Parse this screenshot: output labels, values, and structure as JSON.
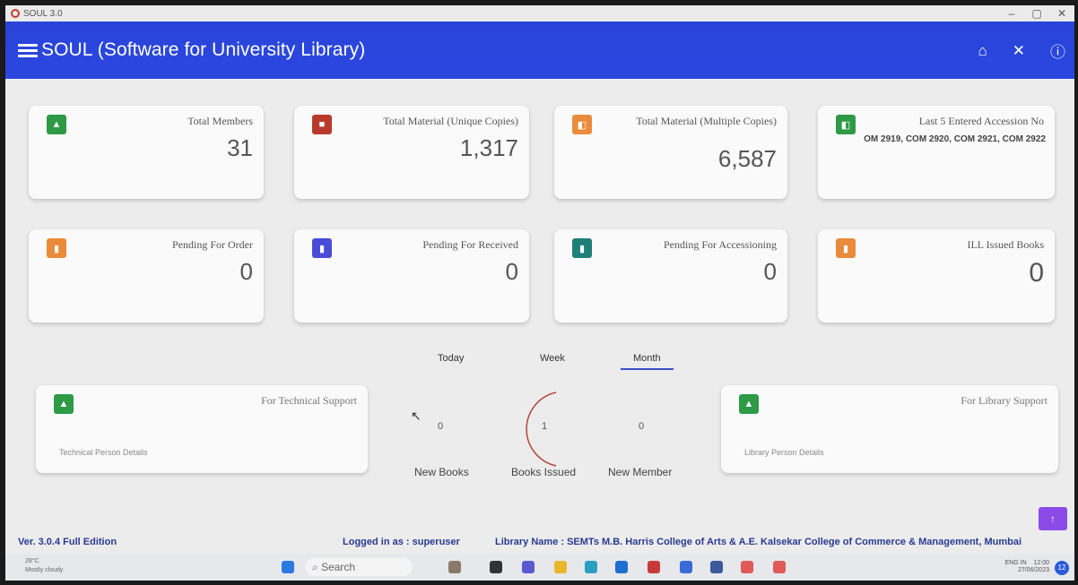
{
  "window": {
    "title": "SOUL 3.0",
    "min": "–",
    "max": "▢",
    "close": "✕"
  },
  "app": {
    "title": "SOUL (Software for University Library)"
  },
  "cards_top": [
    {
      "label": "Total Members",
      "value": "31",
      "color": "#2e9a46",
      "icon": "person-icon"
    },
    {
      "label": "Total Material (Unique Copies)",
      "value": "1,317",
      "color": "#b83a2c",
      "icon": "book-icon"
    },
    {
      "label": "Total Material (Multiple Copies)",
      "value": "6,587",
      "color": "#e98b3a",
      "icon": "copies-icon"
    },
    {
      "label": "Last 5 Entered Accession No",
      "value": "OM 2919, COM 2920, COM 2921, COM 2922",
      "color": "#2e9a46",
      "icon": "copies-icon"
    }
  ],
  "cards_mid": [
    {
      "label": "Pending For Order",
      "value": "0",
      "color": "#e98b3a",
      "icon": "bookmark-icon"
    },
    {
      "label": "Pending For Received",
      "value": "0",
      "color": "#4a4cd8",
      "icon": "bookmark-icon"
    },
    {
      "label": "Pending For Accessioning",
      "value": "0",
      "color": "#1f7f79",
      "icon": "bookmark-icon"
    },
    {
      "label": "ILL Issued Books",
      "value": "0",
      "color": "#e98b3a",
      "icon": "bookmark-icon"
    }
  ],
  "support": {
    "technical": {
      "label": "For Technical Support",
      "details": "Technical Person Details"
    },
    "library": {
      "label": "For Library Support",
      "details": "Library Person Details"
    }
  },
  "tabs": [
    "Today",
    "Week",
    "Month"
  ],
  "active_tab": "Month",
  "stats": [
    {
      "label": "New Books",
      "value": "0"
    },
    {
      "label": "Books Issued",
      "value": "1"
    },
    {
      "label": "New Member",
      "value": "0"
    }
  ],
  "status": {
    "version": "Ver. 3.0.4  Full Edition",
    "login": "Logged in as : superuser",
    "library": "Library Name : SEMTs M.B. Harris College of Arts & A.E. Kalsekar College of Commerce & Management, Mumbai"
  },
  "taskbar": {
    "weather_temp": "28°C",
    "weather_desc": "Mostly cloudy",
    "search": "Search",
    "lang": "ENG",
    "region": "IN",
    "time": "12:00",
    "date": "27/06/2023",
    "badge": "12"
  }
}
